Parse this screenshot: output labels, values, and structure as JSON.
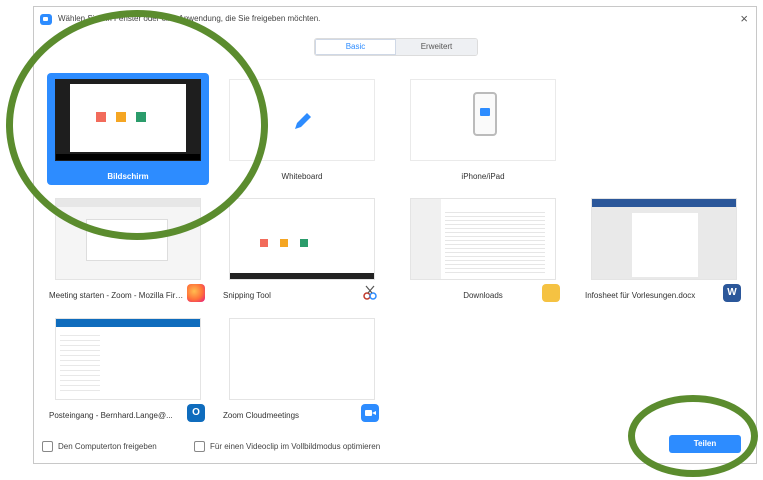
{
  "window": {
    "title": "Wählen Sie ein Fenster oder eine Anwendung, die Sie freigeben möchten.",
    "close_glyph": "×"
  },
  "tabs": [
    {
      "label": "Basic",
      "active": true
    },
    {
      "label": "Erweitert",
      "active": false
    }
  ],
  "tiles": [
    {
      "label": "Bildschirm",
      "selected": true
    },
    {
      "label": "Whiteboard",
      "selected": false
    },
    {
      "label": "iPhone/iPad",
      "selected": false
    },
    {
      "label": "Meeting starten - Zoom - Mozilla Firefox",
      "app_icon": "firefox-icon"
    },
    {
      "label": "Snipping Tool",
      "app_icon": "snipping-tool-icon"
    },
    {
      "label": "Downloads",
      "app_icon": "folder-download-icon"
    },
    {
      "label": "Infosheet für Vorlesungen.docx",
      "app_icon": "word-icon"
    },
    {
      "label": "Posteingang - Bernhard.Lange@...",
      "app_icon": "outlook-icon"
    },
    {
      "label": "Zoom Cloudmeetings",
      "app_icon": "zoom-icon"
    }
  ],
  "footer": {
    "checkbox_audio": "Den Computerton freigeben",
    "checkbox_video": "Für einen Videoclip im Vollbildmodus optimieren",
    "share_button": "Teilen"
  },
  "colors": {
    "accent": "#2d8cff",
    "highlight_annotation": "#5b8c2e"
  }
}
